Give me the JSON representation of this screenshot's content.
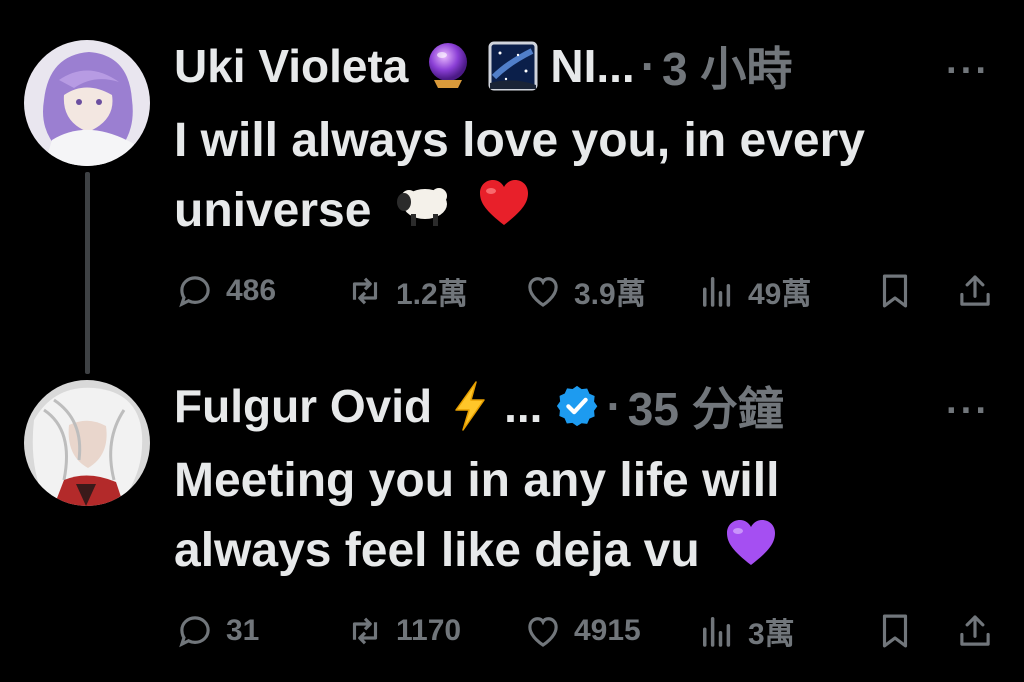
{
  "tweets": [
    {
      "author": "Uki Violeta",
      "name_suffix": "NI...",
      "separator": "·",
      "time": "3 小時",
      "more": "···",
      "text_lines": [
        "I will always love you, in every",
        "universe"
      ],
      "stats": {
        "replies": "486",
        "retweets": "1.2萬",
        "likes": "3.9萬",
        "views": "49萬"
      },
      "header_icons": [
        "crystal-ball-icon",
        "night-sky-icon"
      ],
      "text_icons": [
        "sheep-icon",
        "red-heart-icon"
      ]
    },
    {
      "author": "Fulgur Ovid",
      "name_suffix": "...",
      "separator": "·",
      "time": "35 分鐘",
      "more": "···",
      "text_lines": [
        "Meeting you in any life will",
        "always feel like deja vu"
      ],
      "stats": {
        "replies": "31",
        "retweets": "1170",
        "likes": "4915",
        "views": "3萬"
      },
      "header_icons": [
        "lightning-icon",
        "verified-badge-icon"
      ],
      "text_icons": [
        "purple-heart-icon"
      ]
    }
  ],
  "colors": {
    "background": "#000000",
    "text": "#e7e9ea",
    "muted": "#71767b",
    "verified": "#1d9bf0",
    "thread_line": "#3e4144"
  }
}
